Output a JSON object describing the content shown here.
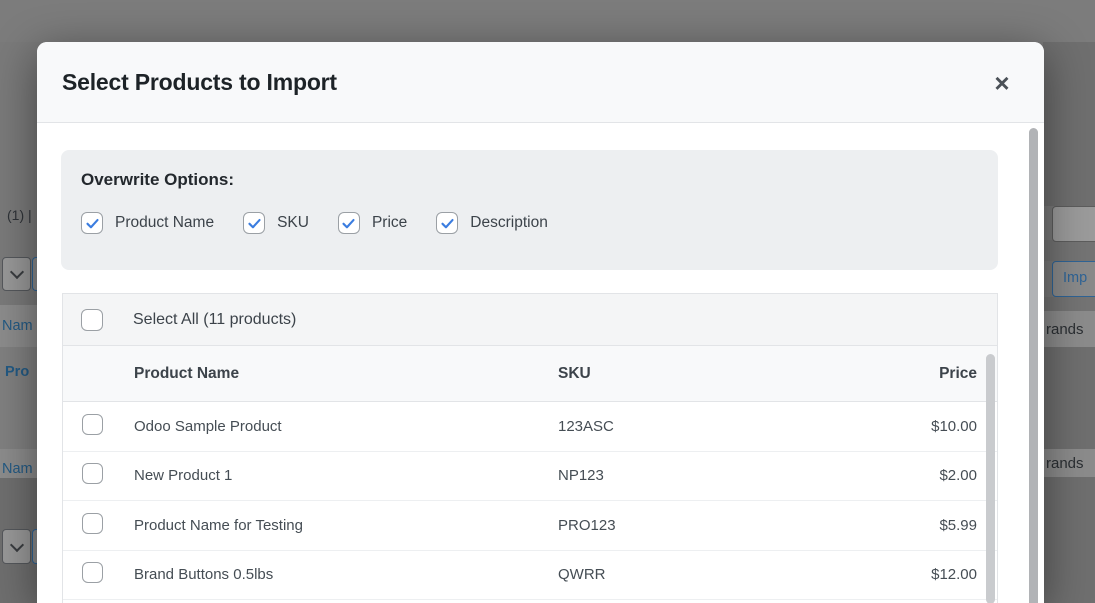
{
  "modal": {
    "title": "Select Products to Import",
    "close_glyph": "×",
    "overwrite": {
      "heading": "Overwrite Options:",
      "options": [
        {
          "label": "Product Name",
          "checked": true
        },
        {
          "label": "SKU",
          "checked": true
        },
        {
          "label": "Price",
          "checked": true
        },
        {
          "label": "Description",
          "checked": true
        }
      ]
    },
    "select_all_label": "Select All (11 products)",
    "table": {
      "columns": [
        "Product Name",
        "SKU",
        "Price"
      ],
      "rows": [
        {
          "name": "Odoo Sample Product",
          "sku": "123ASC",
          "price": "$10.00",
          "checked": false
        },
        {
          "name": "New Product 1",
          "sku": "NP123",
          "price": "$2.00",
          "checked": false
        },
        {
          "name": "Product Name for Testing",
          "sku": "PRO123",
          "price": "$5.99",
          "checked": false
        },
        {
          "name": "Brand Buttons 0.5lbs",
          "sku": "QWRR",
          "price": "$12.00",
          "checked": false
        }
      ]
    }
  },
  "background": {
    "left": {
      "count_text": "(1) |",
      "column_link_1": "Nam",
      "product_link": "Pro",
      "column_link_2": "Nam"
    },
    "right": {
      "import_button_label": "Imp",
      "column_header_1": "rands",
      "column_header_2": "rands"
    }
  },
  "colors": {
    "check_blue": "#3b7de0",
    "link_blue": "#2f6496",
    "modal_header_bg": "#f8f9fa",
    "panel_bg": "#edeff1",
    "row_band_bg": "#f4f5f6",
    "backdrop": "#7a7a7a"
  }
}
